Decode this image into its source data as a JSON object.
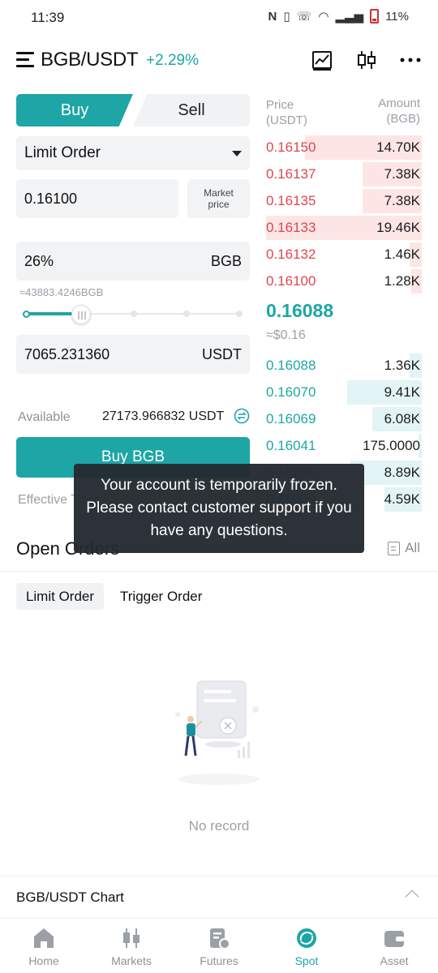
{
  "status_bar": {
    "time": "11:39",
    "battery": "11%"
  },
  "header": {
    "pair": "BGB/USDT",
    "change": "+2.29%"
  },
  "trade_tabs": {
    "buy": "Buy",
    "sell": "Sell"
  },
  "form": {
    "order_type": "Limit Order",
    "price": "0.16100",
    "market_price_label": "Market price",
    "amount_percent": "26%",
    "amount_unit": "BGB",
    "approx_amount": "≈43883.4246BGB",
    "slider_fraction": 0.26,
    "total": "7065.231360",
    "total_unit": "USDT",
    "available_label": "Available",
    "available_value": "27173.966832 USDT",
    "buy_button": "Buy BGB",
    "effective_label": "Effective Time"
  },
  "order_book": {
    "price_header": "Price\n(USDT)",
    "amount_header": "Amount\n(BGB)",
    "asks": [
      {
        "price": "0.16150",
        "amount": "14.70K",
        "depth": 0.75
      },
      {
        "price": "0.16137",
        "amount": "7.38K",
        "depth": 0.38
      },
      {
        "price": "0.16135",
        "amount": "7.38K",
        "depth": 0.38
      },
      {
        "price": "0.16133",
        "amount": "19.46K",
        "depth": 1.0
      },
      {
        "price": "0.16132",
        "amount": "1.46K",
        "depth": 0.08
      },
      {
        "price": "0.16100",
        "amount": "1.28K",
        "depth": 0.07
      }
    ],
    "last_price": "0.16088",
    "last_usd": "≈$0.16",
    "bids": [
      {
        "price": "0.16088",
        "amount": "1.36K",
        "depth": 0.08
      },
      {
        "price": "0.16070",
        "amount": "9.41K",
        "depth": 0.48
      },
      {
        "price": "0.16069",
        "amount": "6.08K",
        "depth": 0.32
      },
      {
        "price": "0.16041",
        "amount": "175.0000",
        "depth": 0.01
      },
      {
        "price": "0.16040",
        "amount": "8.89K",
        "depth": 0.46
      },
      {
        "price": "0.16039",
        "amount": "4.59K",
        "depth": 0.24
      }
    ]
  },
  "open_orders": {
    "title": "Open Orders",
    "all_label": "All",
    "tabs": [
      "Limit Order",
      "Trigger Order"
    ],
    "empty_text": "No record"
  },
  "chart_section": {
    "label": "BGB/USDT Chart"
  },
  "bottom_nav": [
    {
      "label": "Home",
      "icon": "home-icon",
      "active": false
    },
    {
      "label": "Markets",
      "icon": "candlestick-icon",
      "active": false
    },
    {
      "label": "Futures",
      "icon": "futures-icon",
      "active": false
    },
    {
      "label": "Spot",
      "icon": "spot-icon",
      "active": true
    },
    {
      "label": "Asset",
      "icon": "wallet-icon",
      "active": false
    }
  ],
  "toast": {
    "message": "Your account is temporarily frozen. Please contact customer support if you have any questions."
  },
  "colors": {
    "accent": "#1ea5a6",
    "ask": "#e0464d",
    "toast_bg": "#242a30"
  }
}
